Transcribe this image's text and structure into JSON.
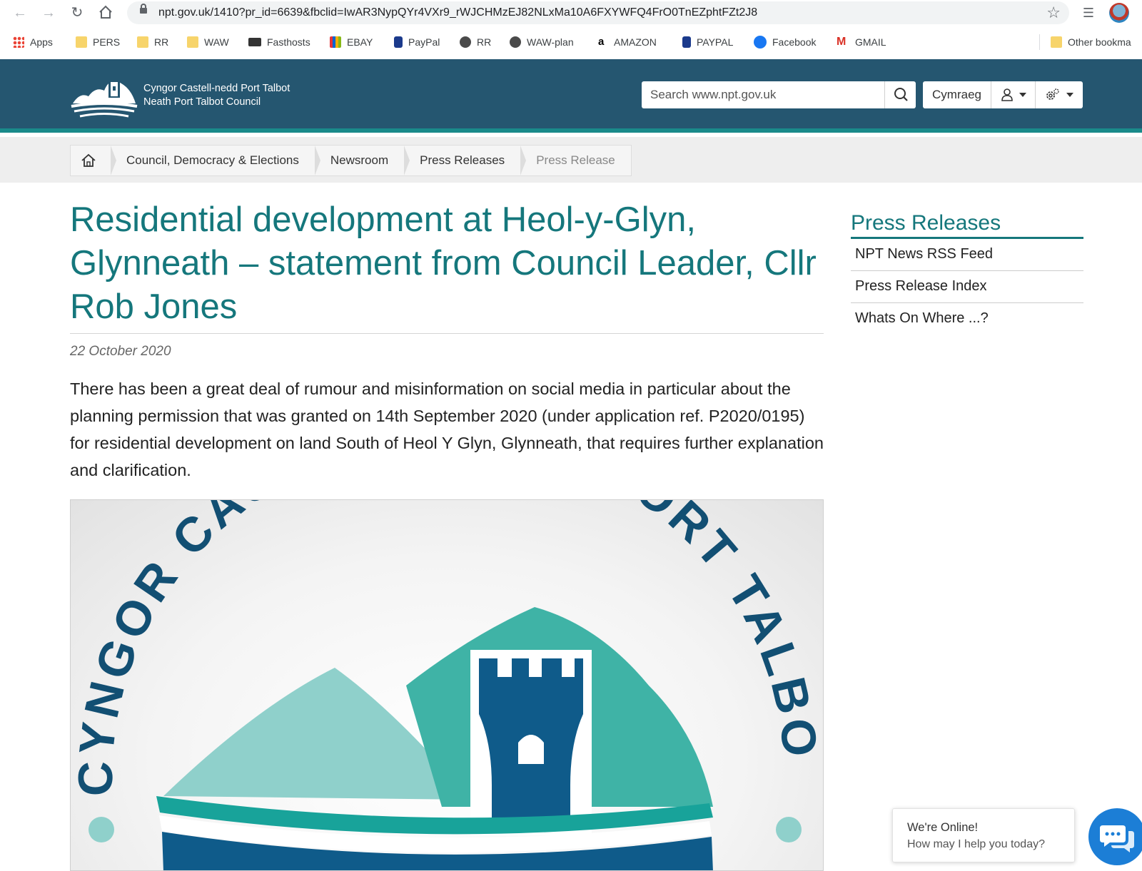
{
  "browser": {
    "url": "npt.gov.uk/1410?pr_id=6639&fbclid=IwAR3NypQYr4VXr9_rWJCHMzEJ82NLxMa10A6FXYWFQ4FrO0TnEZphtFZt2J8",
    "bookmarks": [
      {
        "label": "Apps",
        "icon": "apps-grid-icon"
      },
      {
        "label": "PERS",
        "icon": "folder-icon"
      },
      {
        "label": "RR",
        "icon": "folder-icon"
      },
      {
        "label": "WAW",
        "icon": "folder-icon"
      },
      {
        "label": "Fasthosts",
        "icon": "envelope-icon"
      },
      {
        "label": "EBAY",
        "icon": "shopping-bag-icon"
      },
      {
        "label": "PayPal",
        "icon": "paypal-icon"
      },
      {
        "label": "RR",
        "icon": "globe-icon"
      },
      {
        "label": "WAW-plan",
        "icon": "globe-icon"
      },
      {
        "label": "AMAZON",
        "icon": "amazon-icon"
      },
      {
        "label": "PAYPAL",
        "icon": "paypal-icon"
      },
      {
        "label": "Facebook",
        "icon": "facebook-icon"
      },
      {
        "label": "GMAIL",
        "icon": "gmail-icon"
      }
    ],
    "other_bookmarks": "Other bookma"
  },
  "header": {
    "brand_line1": "Cyngor Castell-nedd Port Talbot",
    "brand_line2": "Neath Port Talbot Council",
    "search_placeholder": "Search www.npt.gov.uk",
    "language_label": "Cymraeg"
  },
  "breadcrumb": [
    {
      "label": "Council, Democracy & Elections"
    },
    {
      "label": "Newsroom"
    },
    {
      "label": "Press Releases"
    },
    {
      "label": "Press Release"
    }
  ],
  "article": {
    "title": "Residential development at Heol-y-Glyn, Glynneath – statement from Council Leader, Cllr Rob Jones",
    "date": "22 October 2020",
    "lead": "There has been a great deal of rumour and misinformation on social media in particular about the planning permission that was granted on 14th September 2020 (under application ref. P2020/0195) for residential development on land South of Heol Y Glyn, Glynneath, that requires further explanation and clarification.",
    "image_logo_text": "CYNGOR CASTELL-NEDD PORT TALBOT"
  },
  "sidebar": {
    "title": "Press Releases",
    "links": [
      "NPT News RSS Feed",
      "Press Release Index",
      "Whats On Where ...?"
    ]
  },
  "chat": {
    "line1": "We're Online!",
    "line2": "How may I help you today?"
  },
  "colors": {
    "header_bg": "#255670",
    "accent_teal": "#15777c",
    "header_stripe": "#1a8a8a"
  }
}
